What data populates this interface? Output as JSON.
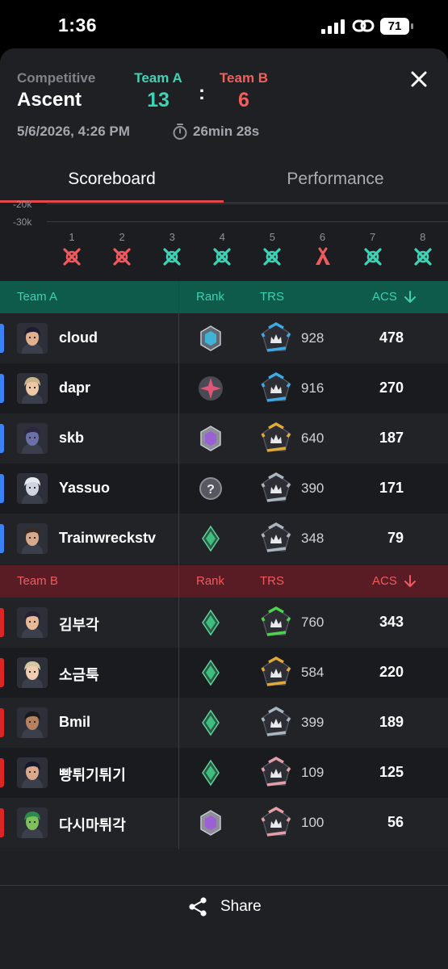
{
  "status_bar": {
    "time": "1:36",
    "battery": "71"
  },
  "header": {
    "mode": "Competitive",
    "map": "Ascent",
    "team_a_label": "Team A",
    "team_a_score": "13",
    "colon": ":",
    "team_b_label": "Team B",
    "team_b_score": "6",
    "date": "5/6/2026, 4:26 PM",
    "duration": "26min 28s"
  },
  "tabs": {
    "scoreboard": "Scoreboard",
    "performance": "Performance"
  },
  "chart": {
    "ticks": [
      "-20k",
      "-30k"
    ],
    "rounds": [
      {
        "n": "1",
        "result": "lost",
        "icon": "elimination-icon"
      },
      {
        "n": "2",
        "result": "lost",
        "icon": "elimination-icon"
      },
      {
        "n": "3",
        "result": "won",
        "icon": "elimination-icon"
      },
      {
        "n": "4",
        "result": "won",
        "icon": "elimination-icon"
      },
      {
        "n": "5",
        "result": "won",
        "icon": "elimination-icon"
      },
      {
        "n": "6",
        "result": "lost",
        "icon": "defuse-icon"
      },
      {
        "n": "7",
        "result": "won",
        "icon": "elimination-icon"
      },
      {
        "n": "8",
        "result": "won",
        "icon": "elimination-icon"
      }
    ]
  },
  "columns": {
    "rank": "Rank",
    "trs": "TRS",
    "acs": "ACS"
  },
  "team_a": {
    "label": "Team A",
    "players": [
      {
        "name": "cloud",
        "trs": "928",
        "acs": "478"
      },
      {
        "name": "dapr",
        "trs": "916",
        "acs": "270"
      },
      {
        "name": "skb",
        "trs": "640",
        "acs": "187"
      },
      {
        "name": "Yassuo",
        "trs": "390",
        "acs": "171"
      },
      {
        "name": "Trainwreckstv",
        "trs": "348",
        "acs": "79"
      }
    ]
  },
  "team_b": {
    "label": "Team B",
    "players": [
      {
        "name": "김부각",
        "trs": "760",
        "acs": "343"
      },
      {
        "name": "소금툭",
        "trs": "584",
        "acs": "220"
      },
      {
        "name": "Bmil",
        "trs": "399",
        "acs": "189"
      },
      {
        "name": "빵튀기튀기",
        "trs": "109",
        "acs": "125"
      },
      {
        "name": "다시마튀각",
        "trs": "100",
        "acs": "56"
      }
    ]
  },
  "footer": {
    "share": "Share"
  },
  "colors": {
    "team_a": "#3fd3b6",
    "team_b": "#f25f5c",
    "round_won": "#3fd3b6",
    "round_lost": "#f05a5e"
  }
}
